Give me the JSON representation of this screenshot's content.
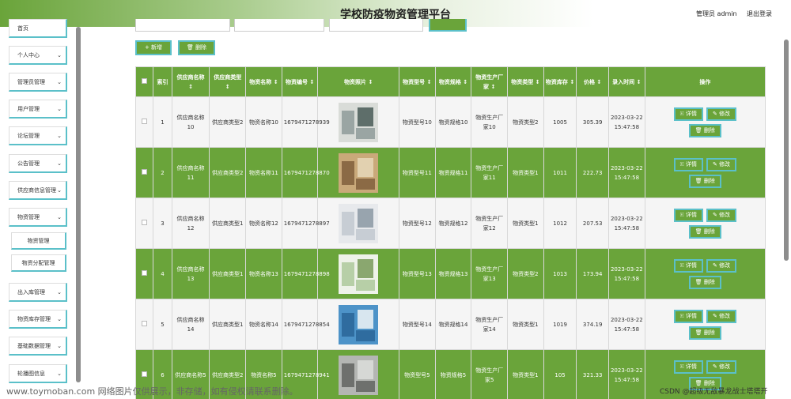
{
  "header": {
    "title": "学校防疫物资管理平台",
    "user": "管理员 admin",
    "logout": "退出登录"
  },
  "sidebar": {
    "items": [
      {
        "label": "首页",
        "chev": false
      },
      {
        "label": "个人中心",
        "chev": true
      },
      {
        "label": "管理员管理",
        "chev": true
      },
      {
        "label": "用户管理",
        "chev": true
      },
      {
        "label": "论坛管理",
        "chev": true
      },
      {
        "label": "公告管理",
        "chev": true
      },
      {
        "label": "供应商信息管理",
        "chev": true
      },
      {
        "label": "物资管理",
        "chev": true
      },
      {
        "label": "出入库管理",
        "chev": true
      },
      {
        "label": "物资库存管理",
        "chev": true
      },
      {
        "label": "基础数据管理",
        "chev": true
      },
      {
        "label": "轮播图信息",
        "chev": true
      }
    ],
    "sub_items": [
      "物资管理",
      "物资分配管理"
    ]
  },
  "toolbar": {
    "add_label": "+ 新增",
    "delete_label": "🗑 删除"
  },
  "table": {
    "headers": [
      "索引",
      "供应商名称 ↕",
      "供应商类型 ↕",
      "物资名称 ↕",
      "物资编号 ↕",
      "物资照片 ↕",
      "物资型号 ↕",
      "物资规格 ↕",
      "物资生产厂家 ↕",
      "物资类型 ↕",
      "物资库存 ↕",
      "价格 ↕",
      "录入时间 ↕",
      "操作"
    ],
    "rows": [
      {
        "idx": "1",
        "supplier": "供应商名称10",
        "stype": "供应商类型2",
        "name": "物资名称10",
        "code": "1679471278939",
        "model": "物资型号10",
        "spec": "物资规格10",
        "maker": "物资生产厂家10",
        "mtype": "物资类型2",
        "stock": "1005",
        "price": "305.39",
        "time": "2023-03-22 15:47:58"
      },
      {
        "idx": "2",
        "supplier": "供应商名称11",
        "stype": "供应商类型2",
        "name": "物资名称11",
        "code": "1679471278870",
        "model": "物资型号11",
        "spec": "物资规格11",
        "maker": "物资生产厂家11",
        "mtype": "物资类型1",
        "stock": "1011",
        "price": "222.73",
        "time": "2023-03-22 15:47:58"
      },
      {
        "idx": "3",
        "supplier": "供应商名称12",
        "stype": "供应商类型1",
        "name": "物资名称12",
        "code": "1679471278897",
        "model": "物资型号12",
        "spec": "物资规格12",
        "maker": "物资生产厂家12",
        "mtype": "物资类型1",
        "stock": "1012",
        "price": "207.53",
        "time": "2023-03-22 15:47:58"
      },
      {
        "idx": "4",
        "supplier": "供应商名称13",
        "stype": "供应商类型1",
        "name": "物资名称13",
        "code": "1679471278898",
        "model": "物资型号13",
        "spec": "物资规格13",
        "maker": "物资生产厂家13",
        "mtype": "物资类型2",
        "stock": "1013",
        "price": "173.94",
        "time": "2023-03-22 15:47:58"
      },
      {
        "idx": "5",
        "supplier": "供应商名称14",
        "stype": "供应商类型1",
        "name": "物资名称14",
        "code": "1679471278854",
        "model": "物资型号14",
        "spec": "物资规格14",
        "maker": "物资生产厂家14",
        "mtype": "物资类型1",
        "stock": "1019",
        "price": "374.19",
        "time": "2023-03-22 15:47:58"
      },
      {
        "idx": "6",
        "supplier": "供应商名称5",
        "stype": "供应商类型2",
        "name": "物资名称5",
        "code": "1679471278941",
        "model": "物资型号5",
        "spec": "物资规格5",
        "maker": "物资生产厂家5",
        "mtype": "物资类型1",
        "stock": "105",
        "price": "321.33",
        "time": "2023-03-22 15:47:58"
      }
    ],
    "actions": {
      "detail": "🗉 详情",
      "edit": "✎ 修改",
      "delete": "🗑 删除"
    }
  },
  "watermark": {
    "left": "www.toymoban.com 网络图片仅供展示，非存储，如有侵权请联系删除。",
    "right": "CSDN @超级无敌暴龙战士塔塔开"
  },
  "colors": {
    "brand_green": "#6aa43a",
    "border_cyan": "#5bc0c9"
  }
}
